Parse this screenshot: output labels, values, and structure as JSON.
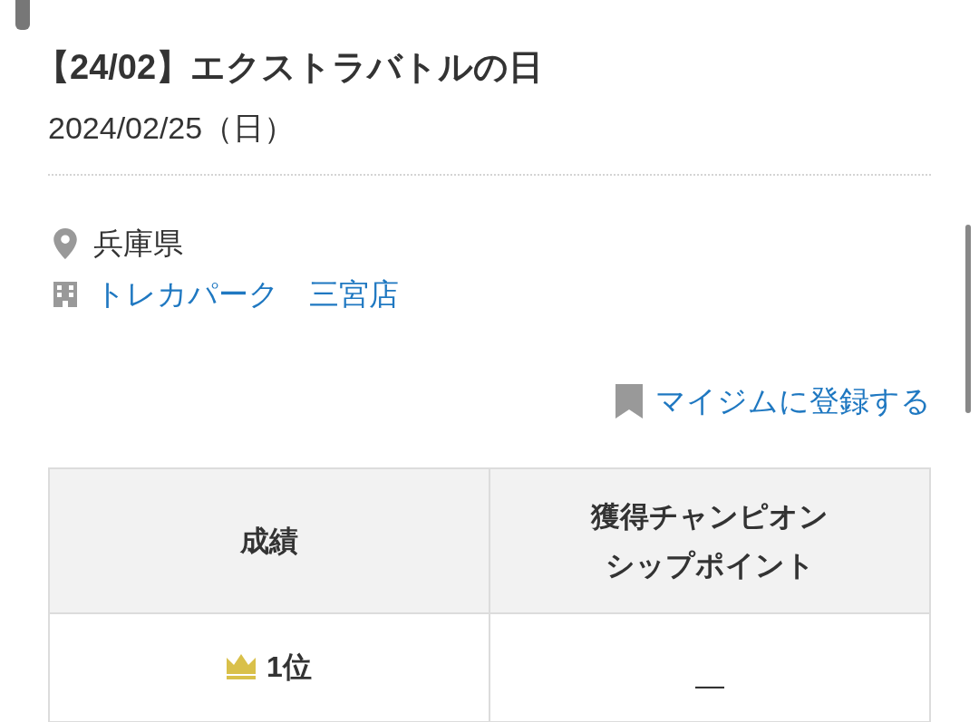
{
  "event": {
    "title": "【24/02】エクストラバトルの日",
    "date": "2024/02/25（日）"
  },
  "venue": {
    "prefecture": "兵庫県",
    "store": "トレカパーク　三宮店"
  },
  "mygym_link": "マイジムに登録する",
  "results_table": {
    "columns": [
      "成績",
      "獲得チャンピオンシップポイント"
    ],
    "rows": [
      {
        "rank": "1位",
        "points": "—"
      }
    ]
  }
}
